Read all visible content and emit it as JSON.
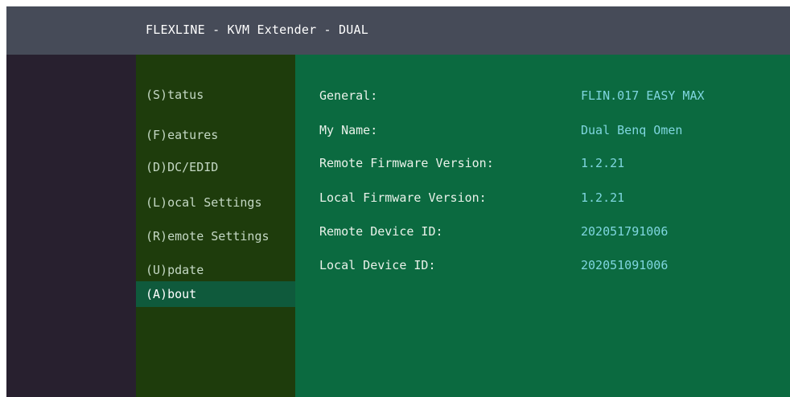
{
  "window": {
    "title": "FLEXLINE - KVM Extender - DUAL"
  },
  "menu": {
    "items": [
      {
        "label": "(S)tatus"
      },
      {
        "label": "(F)eatures"
      },
      {
        "label": "(D)DC/EDID"
      },
      {
        "label": "(L)ocal  Settings"
      },
      {
        "label": "(R)emote Settings"
      },
      {
        "label": "(U)pdate"
      },
      {
        "label": "(A)bout"
      }
    ],
    "active_index": 6
  },
  "about": {
    "rows": [
      {
        "label": "General:",
        "value": "FLIN.017 EASY MAX"
      },
      {
        "label": "My Name:",
        "value": "Dual Benq Omen"
      },
      {
        "label": "Remote Firmware Version:",
        "value": "1.2.21"
      },
      {
        "label": "Local  Firmware Version:",
        "value": "1.2.21"
      },
      {
        "label": "Remote Device ID:",
        "value": "202051791006"
      },
      {
        "label": "Local  Device ID:",
        "value": "202051091006"
      }
    ]
  },
  "colors": {
    "titlebar": "#464b58",
    "background": "#28202f",
    "menu_bg": "#1e3c0c",
    "menu_active": "#0f5a3c",
    "content_bg": "#0b6a40",
    "value_text": "#7fd6df"
  }
}
